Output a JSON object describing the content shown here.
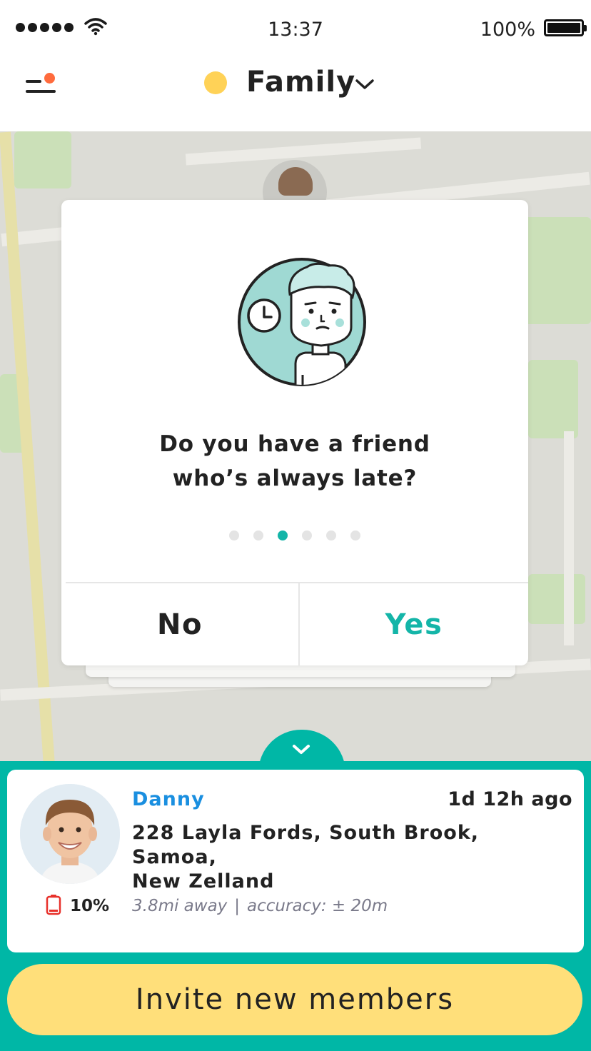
{
  "status_bar": {
    "time": "13:37",
    "battery_percent": "100%"
  },
  "header": {
    "title": "Family",
    "group_color": "#ffd257",
    "notification_color": "#ff6b3d",
    "icons": [
      "menu-icon",
      "chevron-down-icon"
    ]
  },
  "prompt_card": {
    "question_lines": [
      "Do you have a friend",
      "who’s always late?"
    ],
    "illustration": "late-friend-illustration",
    "pager": {
      "total": 6,
      "active_index": 2
    },
    "no_label": "No",
    "yes_label": "Yes",
    "accent_color": "#14b5a8"
  },
  "member": {
    "name": "Danny",
    "last_seen": "1d 12h ago",
    "address_lines": [
      "228 Layla Fords, South Brook, Samoa,",
      "New Zelland"
    ],
    "battery": "10%",
    "distance": "3.8mi away",
    "separator": "|",
    "accuracy": "accuracy: ± 20m"
  },
  "invite_button": {
    "label": "Invite new members",
    "color": "#ffdf7a"
  },
  "panel_color": "#00b7a6"
}
